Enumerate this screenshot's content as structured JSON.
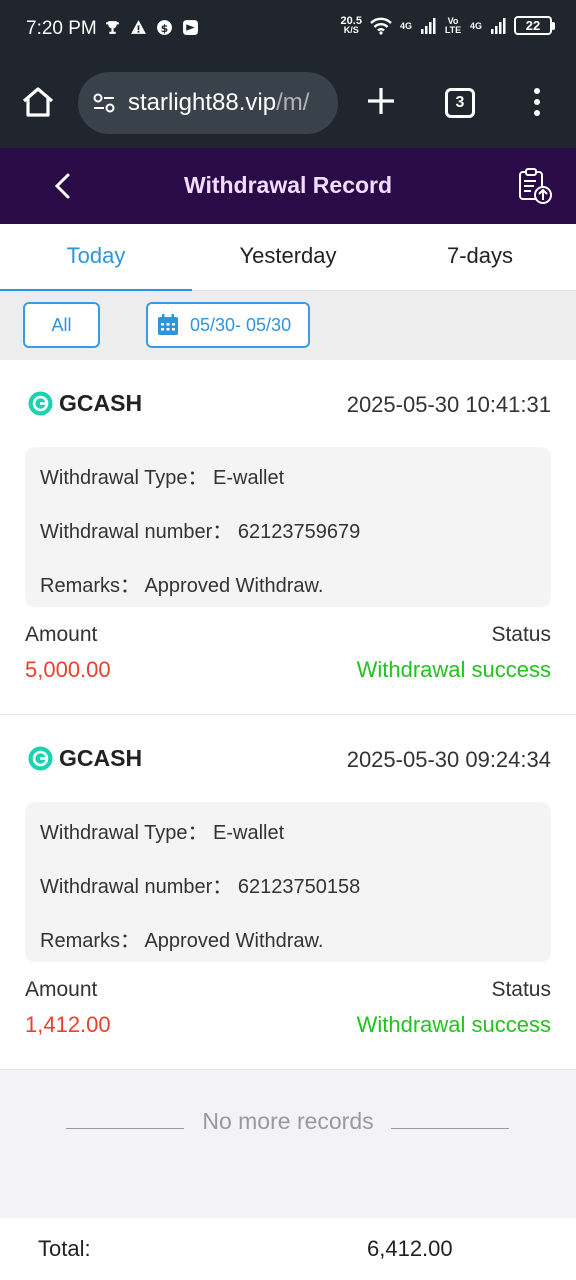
{
  "status_bar": {
    "time": "7:20 PM",
    "net_speed_value": "20.5",
    "net_speed_unit": "K/S",
    "sig1": "4G",
    "volte": "Vo LTE",
    "sig2": "4G",
    "battery": "22"
  },
  "browser": {
    "url_host": "starlight88.vip",
    "url_path": "/m/",
    "tab_count": "3"
  },
  "header": {
    "title": "Withdrawal Record"
  },
  "tabs": [
    {
      "label": "Today",
      "active": true
    },
    {
      "label": "Yesterday",
      "active": false
    },
    {
      "label": "7-days",
      "active": false
    }
  ],
  "filter": {
    "all_label": "All",
    "date_range": "05/30- 05/30"
  },
  "labels": {
    "type": "Withdrawal Type：",
    "number": "Withdrawal number：",
    "remarks": "Remarks：",
    "amount": "Amount",
    "status": "Status"
  },
  "records": [
    {
      "method": "GCASH",
      "datetime": "2025-05-30 10:41:31",
      "type": "E-wallet",
      "number": "62123759679",
      "remarks": "Approved Withdraw.",
      "amount": "5,000.00",
      "status": "Withdrawal success"
    },
    {
      "method": "GCASH",
      "datetime": "2025-05-30 09:24:34",
      "type": "E-wallet",
      "number": "62123750158",
      "remarks": "Approved Withdraw.",
      "amount": "1,412.00",
      "status": "Withdrawal success"
    }
  ],
  "no_more": "No more records",
  "footer": {
    "total_label": "Total:",
    "total_value": "6,412.00"
  },
  "colors": {
    "accent": "#2f95da",
    "header_bg": "#2b0b47",
    "amount": "#e8412c",
    "success": "#22c31c"
  }
}
